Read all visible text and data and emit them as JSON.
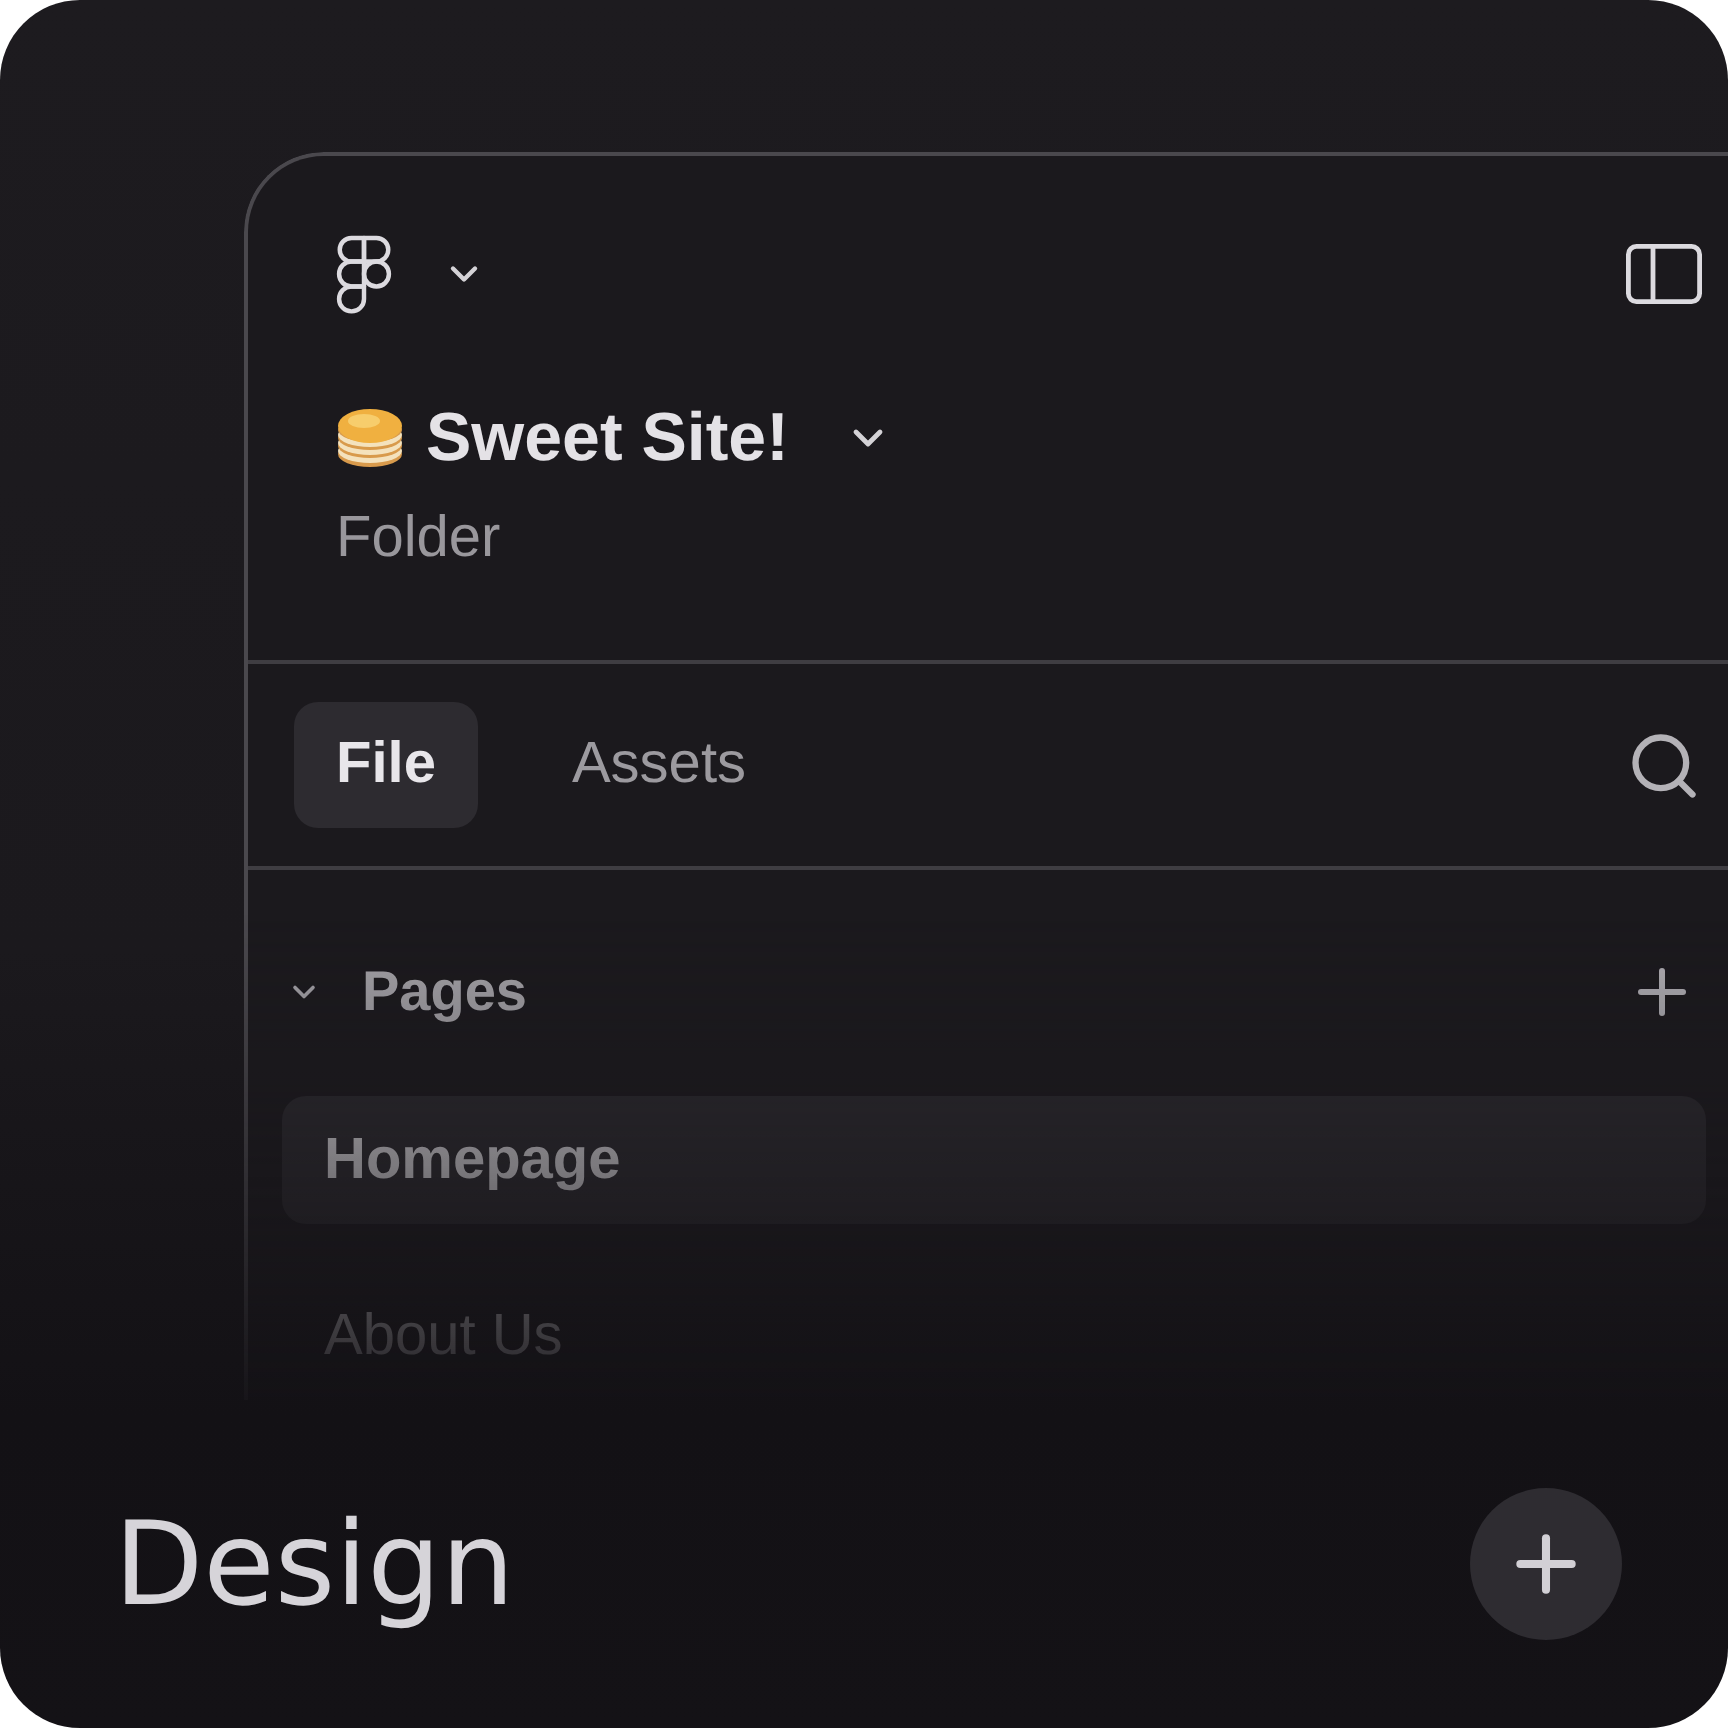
{
  "header": {
    "title": "Sweet Site!",
    "subtitle": "Folder"
  },
  "tabs": [
    {
      "label": "File",
      "selected": true
    },
    {
      "label": "Assets",
      "selected": false
    }
  ],
  "pages_section": {
    "title": "Pages",
    "expanded": true,
    "items": [
      {
        "label": "Homepage",
        "selected": true
      },
      {
        "label": "About Us",
        "selected": false
      }
    ]
  },
  "footer": {
    "title": "Design"
  }
}
